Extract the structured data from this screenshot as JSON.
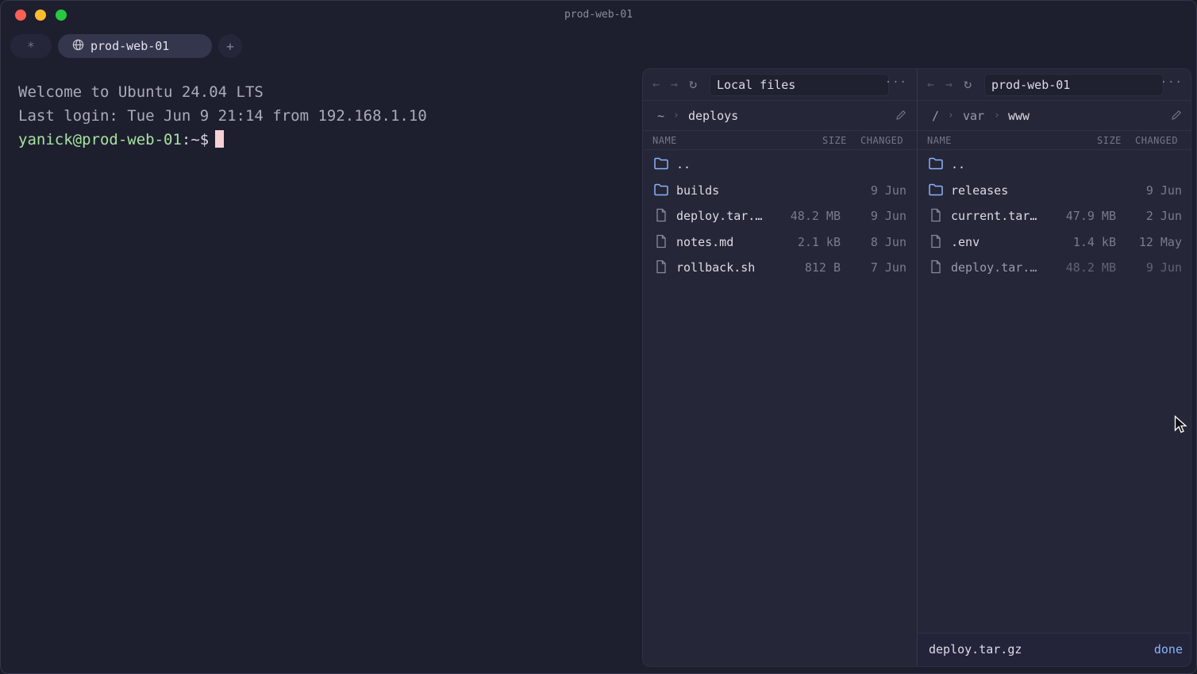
{
  "window": {
    "title": "prod-web-01"
  },
  "tabs": {
    "star_icon": "asterisk-icon",
    "active": {
      "label": "prod-web-01",
      "icon": "globe-icon"
    },
    "add_label": "+"
  },
  "terminal": {
    "lines": [
      "Welcome to Ubuntu 24.04 LTS",
      "Last login: Tue Jun  9 21:14 from 192.168.1.10"
    ],
    "prompt_user": "yanick@prod-web-01",
    "prompt_suffix": ":~$"
  },
  "left_pane": {
    "location": "Local files",
    "breadcrumb": [
      "~",
      "deploys"
    ],
    "columns": {
      "name": "NAME",
      "size": "SIZE",
      "changed": "CHANGED"
    },
    "rows": [
      {
        "name": "..",
        "size": "",
        "changed": "",
        "type": "folder"
      },
      {
        "name": "builds",
        "size": "",
        "changed": "9 Jun",
        "type": "folder"
      },
      {
        "name": "deploy.tar.…",
        "size": "48.2 MB",
        "changed": "9 Jun",
        "type": "file"
      },
      {
        "name": "notes.md",
        "size": "2.1 kB",
        "changed": "8 Jun",
        "type": "file"
      },
      {
        "name": "rollback.sh",
        "size": "812 B",
        "changed": "7 Jun",
        "type": "file"
      }
    ]
  },
  "right_pane": {
    "location": "prod-web-01",
    "breadcrumb": [
      "/",
      "var",
      "www"
    ],
    "columns": {
      "name": "NAME",
      "size": "SIZE",
      "changed": "CHANGED"
    },
    "rows": [
      {
        "name": "..",
        "size": "",
        "changed": "",
        "type": "folder"
      },
      {
        "name": "releases",
        "size": "",
        "changed": "9 Jun",
        "type": "folder"
      },
      {
        "name": "current.tar…",
        "size": "47.9 MB",
        "changed": "2 Jun",
        "type": "file"
      },
      {
        "name": ".env",
        "size": "1.4 kB",
        "changed": "12 May",
        "type": "file"
      },
      {
        "name": "deploy.tar.…",
        "size": "48.2 MB",
        "changed": "9 Jun",
        "type": "file",
        "dim": true
      }
    ]
  },
  "transfer": {
    "file": "deploy.tar.gz",
    "status": "done"
  },
  "colors": {
    "background": "#1e1f2e",
    "prompt_green": "#a6e3a1",
    "folder_blue": "#89b4fa",
    "cursor": "#f5d0d6",
    "status_done": "#89b4fa"
  }
}
